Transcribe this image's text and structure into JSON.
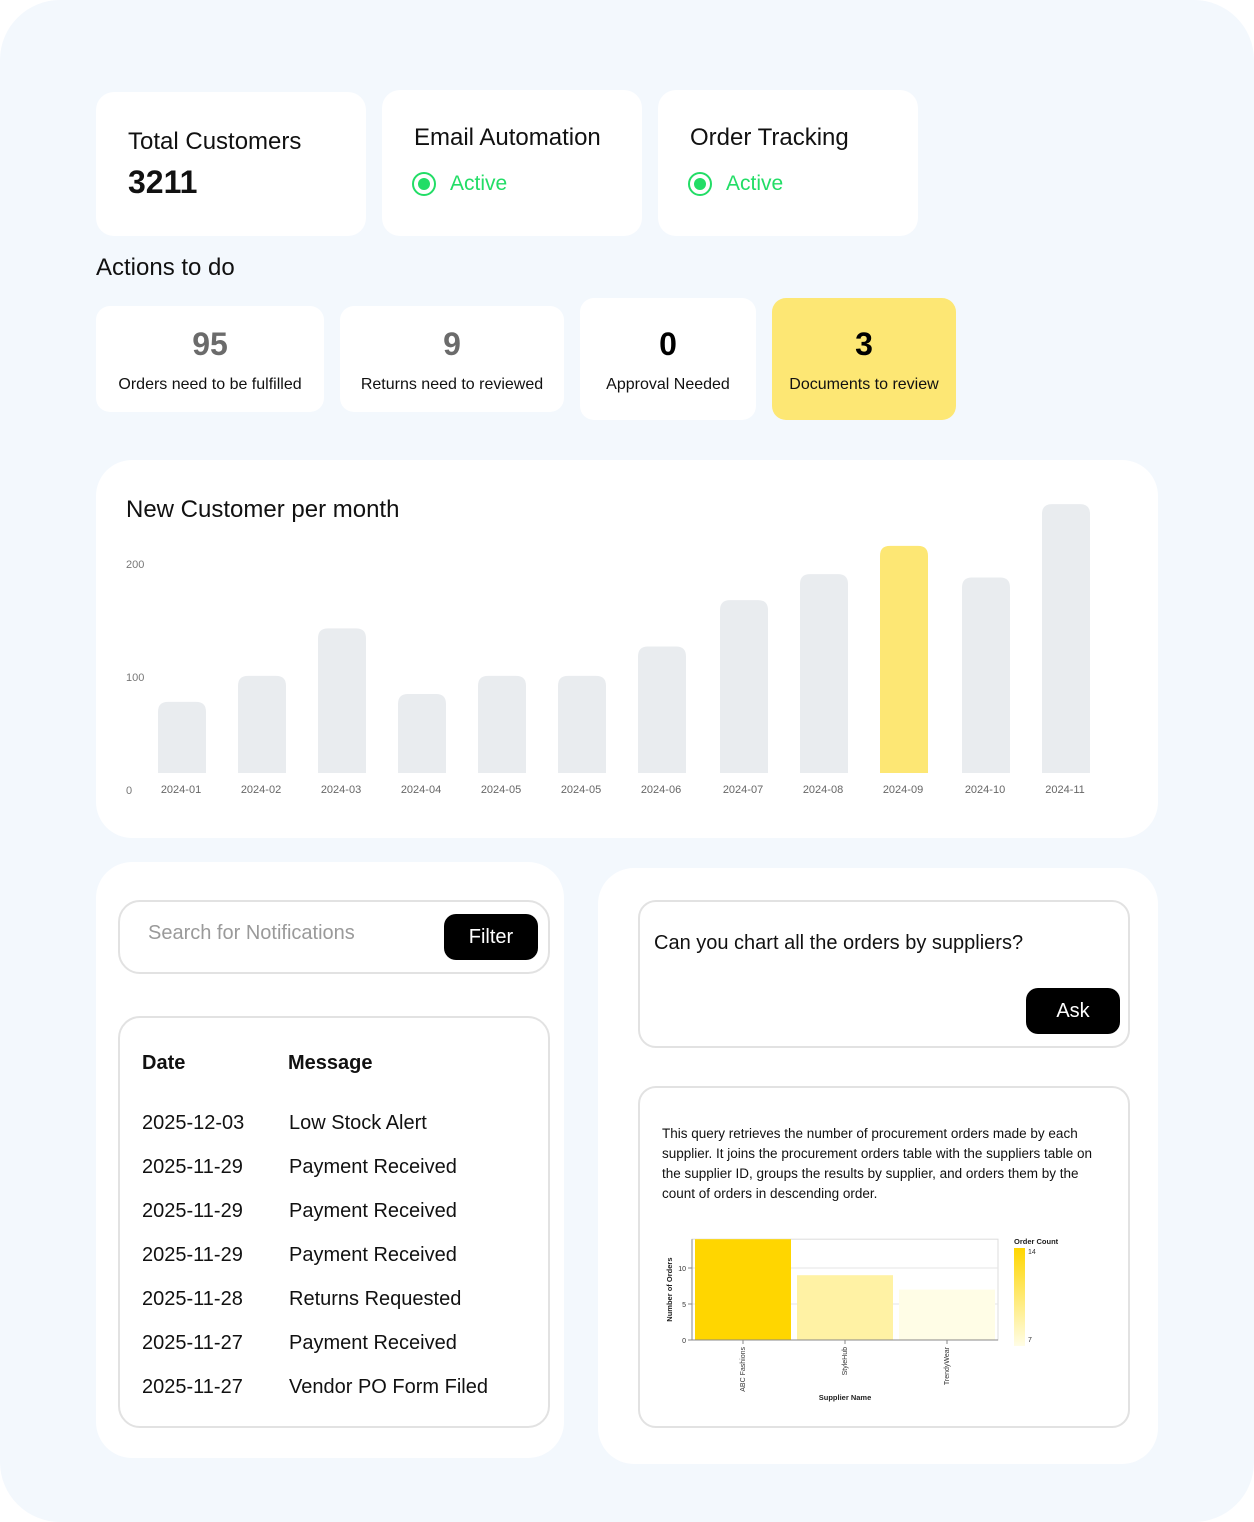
{
  "stats": {
    "total_customers": {
      "title": "Total Customers",
      "value": "3211"
    },
    "email_automation": {
      "title": "Email Automation",
      "status": "Active",
      "status_icon": "radio-active-icon"
    },
    "order_tracking": {
      "title": "Order Tracking",
      "status": "Active",
      "status_icon": "radio-active-icon"
    }
  },
  "colors": {
    "active_green": "#22dd66",
    "highlight_yellow": "#fde774",
    "bar_gray": "#e9ecef",
    "page_bg": "#f3f8fd",
    "supplier_max": "#ffd600",
    "supplier_min": "#fffde6"
  },
  "actions": {
    "title": "Actions to do",
    "items": [
      {
        "count": "95",
        "label": "Orders need to be fulfilled",
        "highlight": false,
        "muted": true
      },
      {
        "count": "9",
        "label": "Returns need to reviewed",
        "highlight": false,
        "muted": true
      },
      {
        "count": "0",
        "label": "Approval Needed",
        "highlight": false,
        "muted": false
      },
      {
        "count": "3",
        "label": "Documents to review",
        "highlight": true,
        "muted": false
      }
    ]
  },
  "notifications": {
    "search_placeholder": "Search for Notifications",
    "search_value": "",
    "filter_label": "Filter",
    "columns": [
      "Date",
      "Message"
    ],
    "rows": [
      {
        "date": "2025-12-03",
        "message": "Low Stock Alert"
      },
      {
        "date": "2025-11-29",
        "message": "Payment Received"
      },
      {
        "date": "2025-11-29",
        "message": "Payment Received"
      },
      {
        "date": "2025-11-29",
        "message": "Payment Received"
      },
      {
        "date": "2025-11-28",
        "message": "Returns Requested"
      },
      {
        "date": "2025-11-27",
        "message": "Payment Received"
      },
      {
        "date": "2025-11-27",
        "message": "Vendor PO Form Filed"
      }
    ]
  },
  "assistant": {
    "question": "Can you chart all the orders by suppliers?",
    "ask_label": "Ask",
    "answer": "This query retrieves the number of procurement orders made by each supplier. It joins the procurement orders table with the suppliers table on the supplier ID, groups the results by supplier, and orders them by the count of orders in descending order."
  },
  "chart_data": [
    {
      "type": "bar",
      "title": "New Customer per month",
      "xlabel": "",
      "ylabel": "",
      "categories": [
        "2024-01",
        "2024-02",
        "2024-03",
        "2024-04",
        "2024-05",
        "2024-05",
        "2024-06",
        "2024-07",
        "2024-08",
        "2024-09",
        "2024-10",
        "2024-11"
      ],
      "values": [
        78,
        101,
        143,
        85,
        101,
        101,
        127,
        168,
        191,
        216,
        188,
        253
      ],
      "highlight_index": 9,
      "yticks": [
        0,
        100,
        200
      ],
      "ylim": [
        0,
        260
      ],
      "grid": false
    },
    {
      "type": "bar",
      "title": "",
      "xlabel": "Supplier Name",
      "ylabel": "Number of Orders",
      "categories": [
        "ABC Fashions",
        "StyleHub",
        "TrendyWear"
      ],
      "values": [
        14,
        9,
        7
      ],
      "yticks": [
        0,
        5,
        10
      ],
      "ylim": [
        0,
        14
      ],
      "grid": true,
      "legend": {
        "title": "Order Count",
        "min": 7,
        "max": 14,
        "placement": "right"
      }
    }
  ]
}
